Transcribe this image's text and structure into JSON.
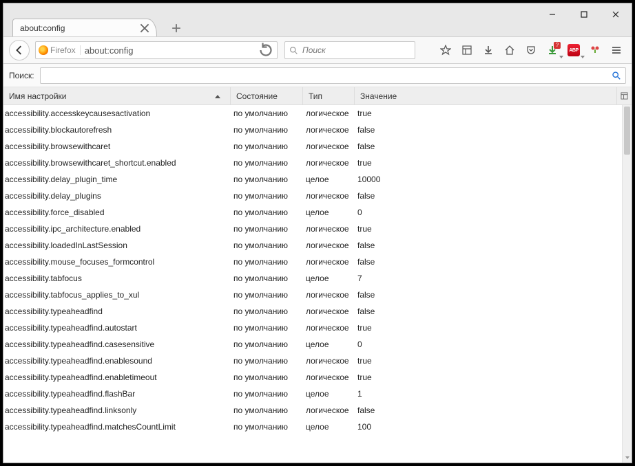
{
  "window": {
    "tab_title": "about:config",
    "identity_label": "Firefox",
    "url": "about:config",
    "search_placeholder": "Поиск"
  },
  "icons": {
    "download_badge": "?",
    "abp_label": "ABP"
  },
  "page": {
    "search_label": "Поиск:",
    "search_value": ""
  },
  "columns": {
    "name": "Имя настройки",
    "state": "Состояние",
    "type": "Тип",
    "value": "Значение"
  },
  "strings": {
    "default": "по умолчанию",
    "bool": "логическое",
    "int": "целое"
  },
  "prefs": [
    {
      "name": "accessibility.accesskeycausesactivation",
      "state": "default",
      "type": "bool",
      "value": "true"
    },
    {
      "name": "accessibility.blockautorefresh",
      "state": "default",
      "type": "bool",
      "value": "false"
    },
    {
      "name": "accessibility.browsewithcaret",
      "state": "default",
      "type": "bool",
      "value": "false"
    },
    {
      "name": "accessibility.browsewithcaret_shortcut.enabled",
      "state": "default",
      "type": "bool",
      "value": "true"
    },
    {
      "name": "accessibility.delay_plugin_time",
      "state": "default",
      "type": "int",
      "value": "10000"
    },
    {
      "name": "accessibility.delay_plugins",
      "state": "default",
      "type": "bool",
      "value": "false"
    },
    {
      "name": "accessibility.force_disabled",
      "state": "default",
      "type": "int",
      "value": "0"
    },
    {
      "name": "accessibility.ipc_architecture.enabled",
      "state": "default",
      "type": "bool",
      "value": "true"
    },
    {
      "name": "accessibility.loadedInLastSession",
      "state": "default",
      "type": "bool",
      "value": "false"
    },
    {
      "name": "accessibility.mouse_focuses_formcontrol",
      "state": "default",
      "type": "bool",
      "value": "false"
    },
    {
      "name": "accessibility.tabfocus",
      "state": "default",
      "type": "int",
      "value": "7"
    },
    {
      "name": "accessibility.tabfocus_applies_to_xul",
      "state": "default",
      "type": "bool",
      "value": "false"
    },
    {
      "name": "accessibility.typeaheadfind",
      "state": "default",
      "type": "bool",
      "value": "false"
    },
    {
      "name": "accessibility.typeaheadfind.autostart",
      "state": "default",
      "type": "bool",
      "value": "true"
    },
    {
      "name": "accessibility.typeaheadfind.casesensitive",
      "state": "default",
      "type": "int",
      "value": "0"
    },
    {
      "name": "accessibility.typeaheadfind.enablesound",
      "state": "default",
      "type": "bool",
      "value": "true"
    },
    {
      "name": "accessibility.typeaheadfind.enabletimeout",
      "state": "default",
      "type": "bool",
      "value": "true"
    },
    {
      "name": "accessibility.typeaheadfind.flashBar",
      "state": "default",
      "type": "int",
      "value": "1"
    },
    {
      "name": "accessibility.typeaheadfind.linksonly",
      "state": "default",
      "type": "bool",
      "value": "false"
    },
    {
      "name": "accessibility.typeaheadfind.matchesCountLimit",
      "state": "default",
      "type": "int",
      "value": "100"
    }
  ]
}
